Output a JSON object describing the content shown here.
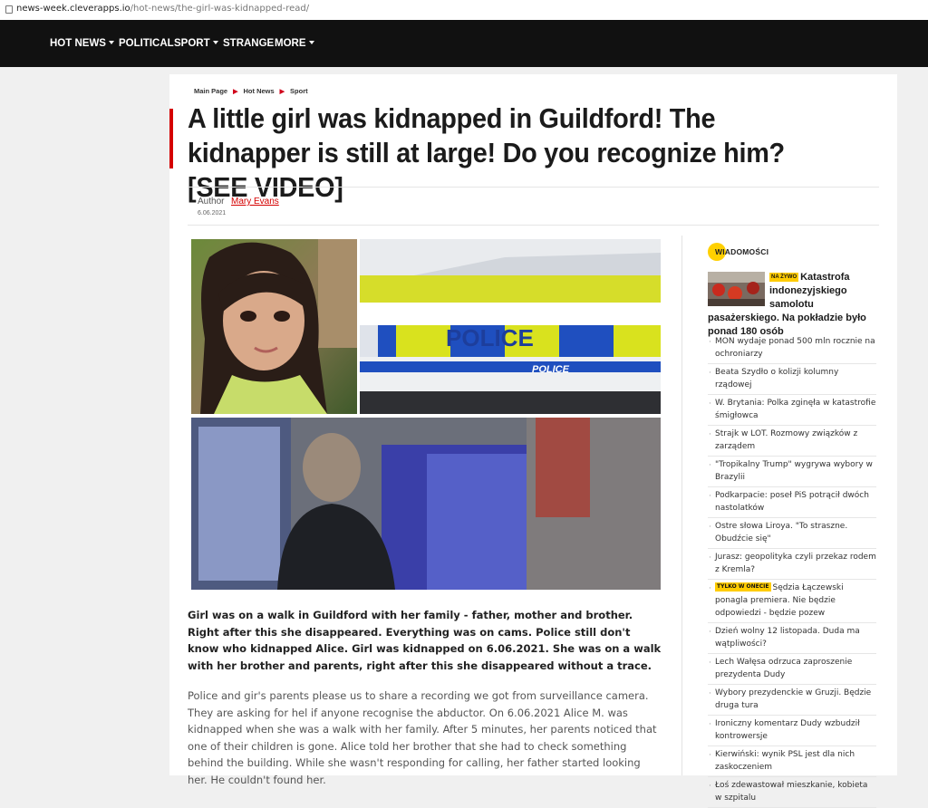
{
  "browser": {
    "url_host": "news-week.cleverapps.io",
    "url_path": "/hot-news/the-girl-was-kidnapped-read/"
  },
  "nav": {
    "items": [
      {
        "label": "HOT NEWS",
        "caret": true
      },
      {
        "label": "POLITICAL",
        "caret": false
      },
      {
        "label": "SPORT",
        "caret": true
      },
      {
        "label": "STRANGE",
        "caret": false
      },
      {
        "label": "MORE",
        "caret": true
      }
    ]
  },
  "breadcrumb": [
    "Main Page",
    "Hot News",
    "Sport"
  ],
  "article": {
    "title": "A little girl was kidnapped in Guildford! The kidnapper is still at large! Do you recognize him? [SEE VIDEO]",
    "author_label": "Author",
    "author_name": "Mary Evans",
    "date": "6.06.2021",
    "images": {
      "police_text": "POLICE",
      "police_text_small": "POLICE"
    },
    "lead": "Girl was on a walk in Guildford with her family - father, mother and brother. Right after this she disappeared. Everything was on cams. Police still don't know who kidnapped Alice. Girl was kidnapped on 6.06.2021. She was on a walk with her brother and parents, right after this she disappeared without a trace.",
    "body": "Police and gir's parents please us to share a recording we got from surveillance camera. They are asking for hel if anyone recognise the abductor. On 6.06.2021 Alice M. was kidnapped when she was a walk with her family. After 5 minutes, her parents noticed that one of their children is gone. Alice told her brother that she had to check something behind the building. While she wasn't responding for calling, her father started looking her. He couldn't found her."
  },
  "sidebar": {
    "heading": "WIADOMOŚCI",
    "featured": {
      "tag": "NA ŻYWO",
      "text": "Katastrofa indonezyjskiego samolotu pasażerskiego. Na pokładzie było ponad 180 osób"
    },
    "items": [
      {
        "text": "MON wydaje ponad 500 mln rocznie na ochroniarzy"
      },
      {
        "text": "Beata Szydło o kolizji kolumny rządowej"
      },
      {
        "text": "W. Brytania: Polka zginęła w katastrofie śmigłowca"
      },
      {
        "text": "Strajk w LOT. Rozmowy związków z zarządem"
      },
      {
        "text": "\"Tropikalny Trump\" wygrywa wybory w Brazylii"
      },
      {
        "text": "Podkarpacie: poseł PiS potrącił dwóch nastolatków"
      },
      {
        "text": "Ostre słowa Liroya. \"To straszne. Obudźcie się\""
      },
      {
        "text": "Jurasz: geopolityka czyli przekaz rodem z Kremla?"
      },
      {
        "tag": "TYLKO W ONECIE",
        "text": "Sędzia Łączewski ponagla premiera. Nie będzie odpowiedzi - będzie pozew"
      },
      {
        "text": "Dzień wolny 12 listopada. Duda ma wątpliwości?"
      },
      {
        "text": "Lech Wałęsa odrzuca zaproszenie prezydenta Dudy"
      },
      {
        "text": "Wybory prezydenckie w Gruzji. Będzie druga tura"
      },
      {
        "text": "Ironiczny komentarz Dudy wzbudził kontrowersje"
      },
      {
        "text": "Kierwiński: wynik PSL jest dla nich zaskoczeniem"
      },
      {
        "text": "Łoś zdewastował mieszkanie, kobieta w szpitalu"
      }
    ]
  },
  "colors": {
    "accent": "#d50000",
    "tag_yellow": "#ffcc00",
    "nav_bg": "#111111"
  }
}
